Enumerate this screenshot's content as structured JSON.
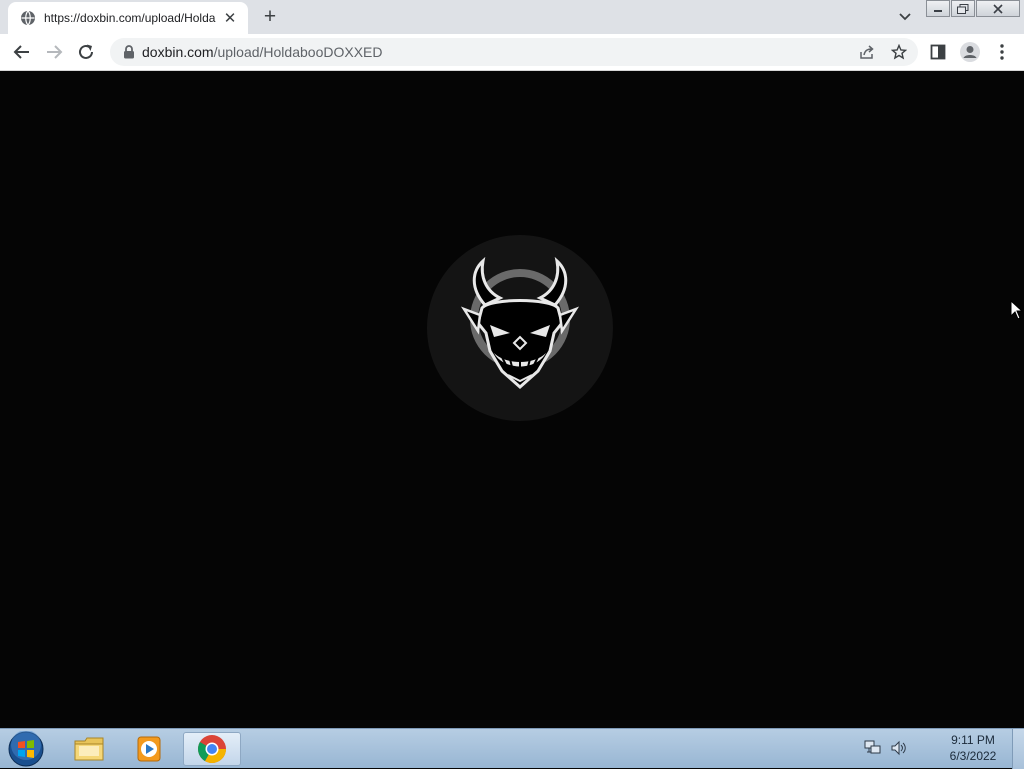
{
  "browser": {
    "tab": {
      "title": "https://doxbin.com/upload/Holda",
      "favicon": "globe-icon"
    },
    "new_tab_label": "+",
    "close_label": "✕",
    "address": {
      "host": "doxbin.com",
      "path": "/upload/HoldabooDOXXED"
    }
  },
  "page": {
    "background": "#050505",
    "logo": "demon-mask-logo"
  },
  "taskbar": {
    "pinned": [
      "start-orb-icon",
      "file-explorer-icon",
      "media-player-icon",
      "chrome-icon"
    ],
    "clock": {
      "time": "9:11 PM",
      "date": "6/3/2022"
    }
  }
}
